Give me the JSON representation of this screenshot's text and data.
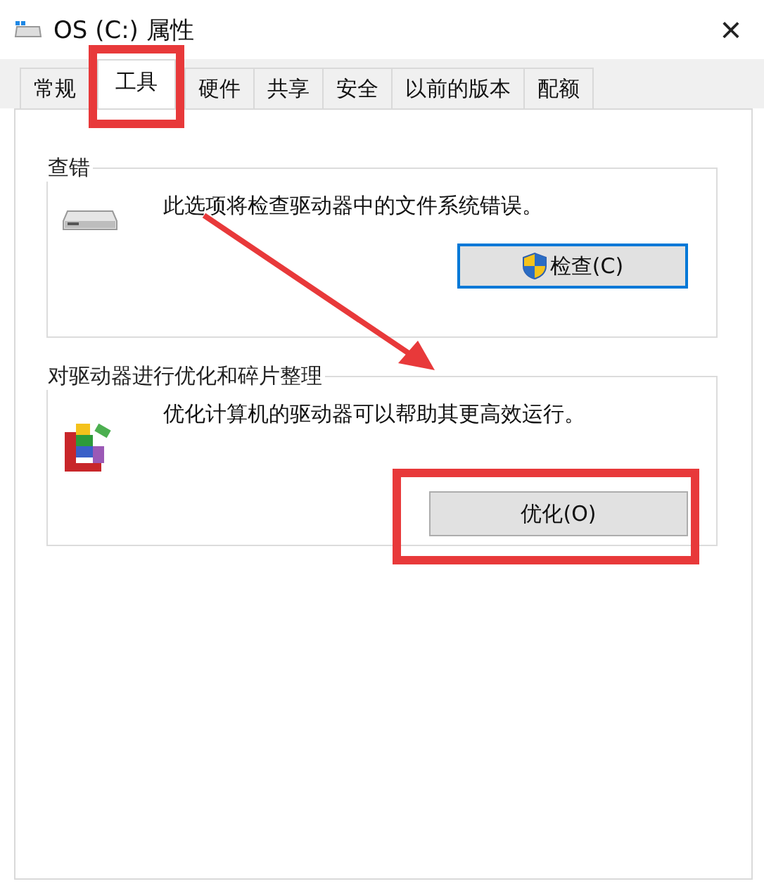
{
  "window": {
    "title": "OS (C:) 属性",
    "close": "×"
  },
  "tabs": [
    {
      "label": "常规",
      "selected": false,
      "highlighted": false
    },
    {
      "label": "工具",
      "selected": true,
      "highlighted": true
    },
    {
      "label": "硬件",
      "selected": false,
      "highlighted": false
    },
    {
      "label": "共享",
      "selected": false,
      "highlighted": false
    },
    {
      "label": "安全",
      "selected": false,
      "highlighted": false
    },
    {
      "label": "以前的版本",
      "selected": false,
      "highlighted": false
    },
    {
      "label": "配额",
      "selected": false,
      "highlighted": false
    }
  ],
  "groups": [
    {
      "title": "查错",
      "kind": "drive",
      "description": "此选项将检查驱动器中的文件系统错误。",
      "button": {
        "label": "检查(C)",
        "shield": true,
        "focused": true,
        "highlighted": false
      }
    },
    {
      "title": "对驱动器进行优化和碎片整理",
      "kind": "defrag",
      "description": "优化计算机的驱动器可以帮助其更高效运行。",
      "button": {
        "label": "优化(O)",
        "shield": false,
        "focused": false,
        "highlighted": true
      }
    }
  ]
}
